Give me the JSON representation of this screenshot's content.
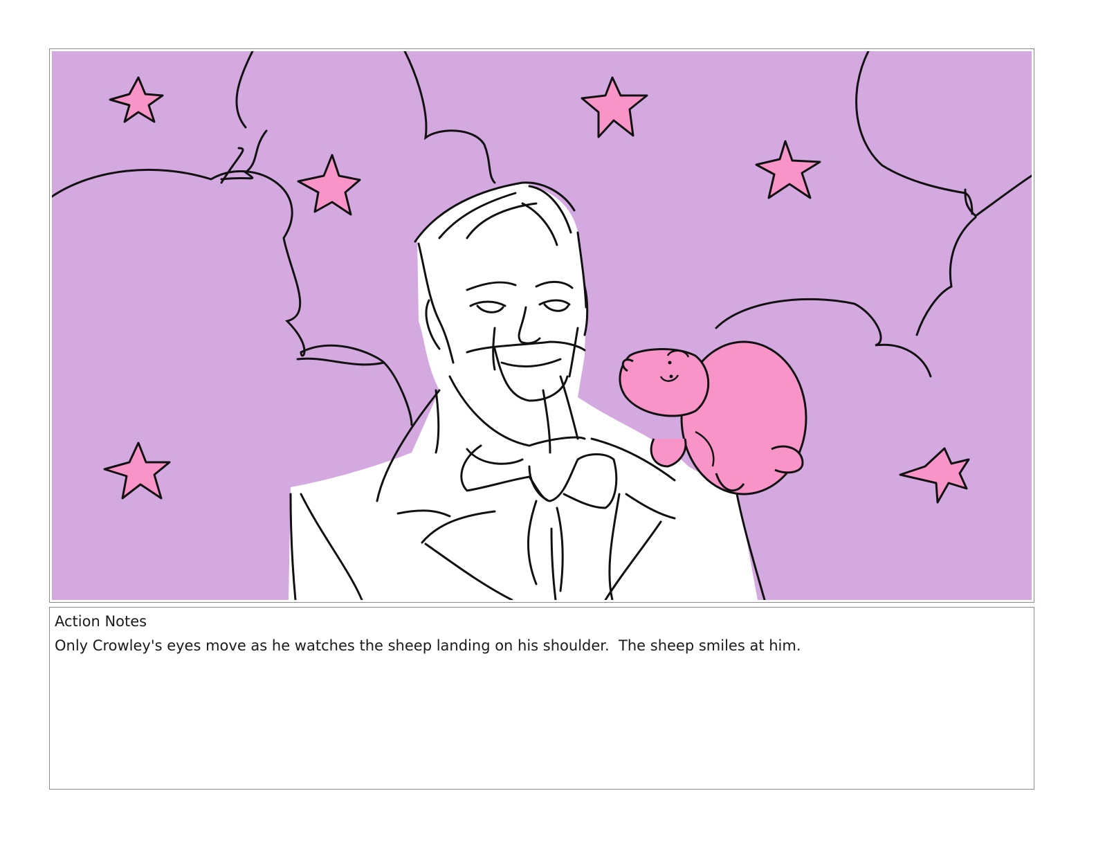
{
  "storyboard": {
    "panel": {
      "background_color": "#d4a9e0",
      "accent_color": "#f994c9",
      "line_color": "#111111",
      "illustration_subjects": [
        "man-in-suit",
        "pink-sheep",
        "stars",
        "clouds"
      ]
    },
    "notes": {
      "heading": "Action Notes",
      "text": "Only Crowley's eyes move as he watches the sheep landing on his shoulder.  The sheep smiles at him."
    }
  }
}
